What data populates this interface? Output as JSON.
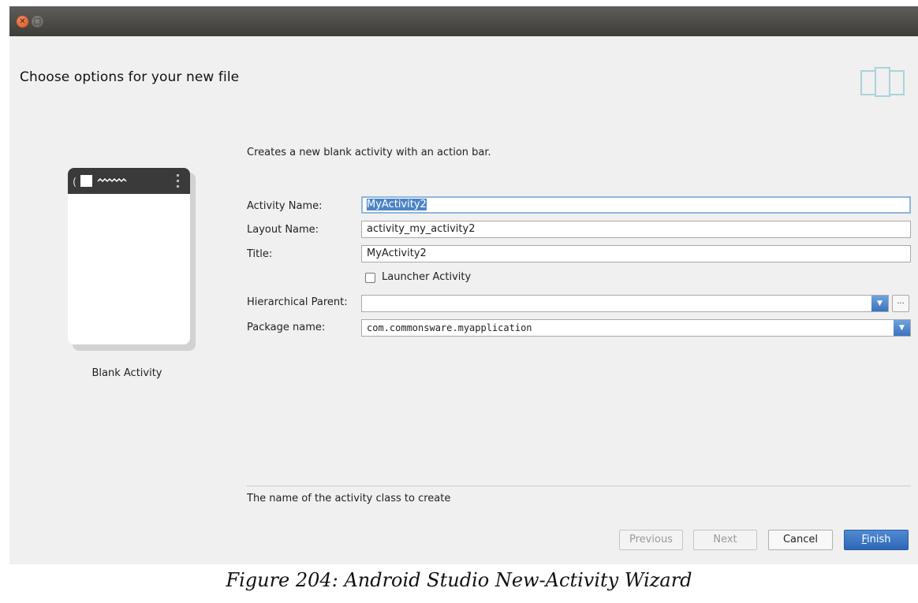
{
  "dialog": {
    "header_title": "Choose options for your new file",
    "template_name": "Blank Activity",
    "description": "Creates a new blank activity with an action bar.",
    "fields": {
      "activity_name": {
        "label": "Activity Name:",
        "value": "MyActivity2"
      },
      "layout_name": {
        "label": "Layout Name:",
        "value": "activity_my_activity2"
      },
      "title": {
        "label": "Title:",
        "value": "MyActivity2"
      },
      "launcher_activity": {
        "label": "Launcher Activity",
        "checked": false
      },
      "hierarchical_parent": {
        "label": "Hierarchical Parent:",
        "value": "",
        "browse_label": "..."
      },
      "package_name": {
        "label": "Package name:",
        "value": "com.commonsware.myapplication"
      }
    },
    "hint": "The name of the activity class to create",
    "buttons": {
      "previous": "Previous",
      "next": "Next",
      "cancel": "Cancel",
      "finish_mnemonic": "F",
      "finish_rest": "inish"
    }
  },
  "caption": "Figure 204: Android Studio New-Activity Wizard",
  "colors": {
    "accent": "#3c73bd",
    "titlebar": "#4a4945",
    "close_button": "#e8602c",
    "dialog_background": "#f0f0f0"
  }
}
